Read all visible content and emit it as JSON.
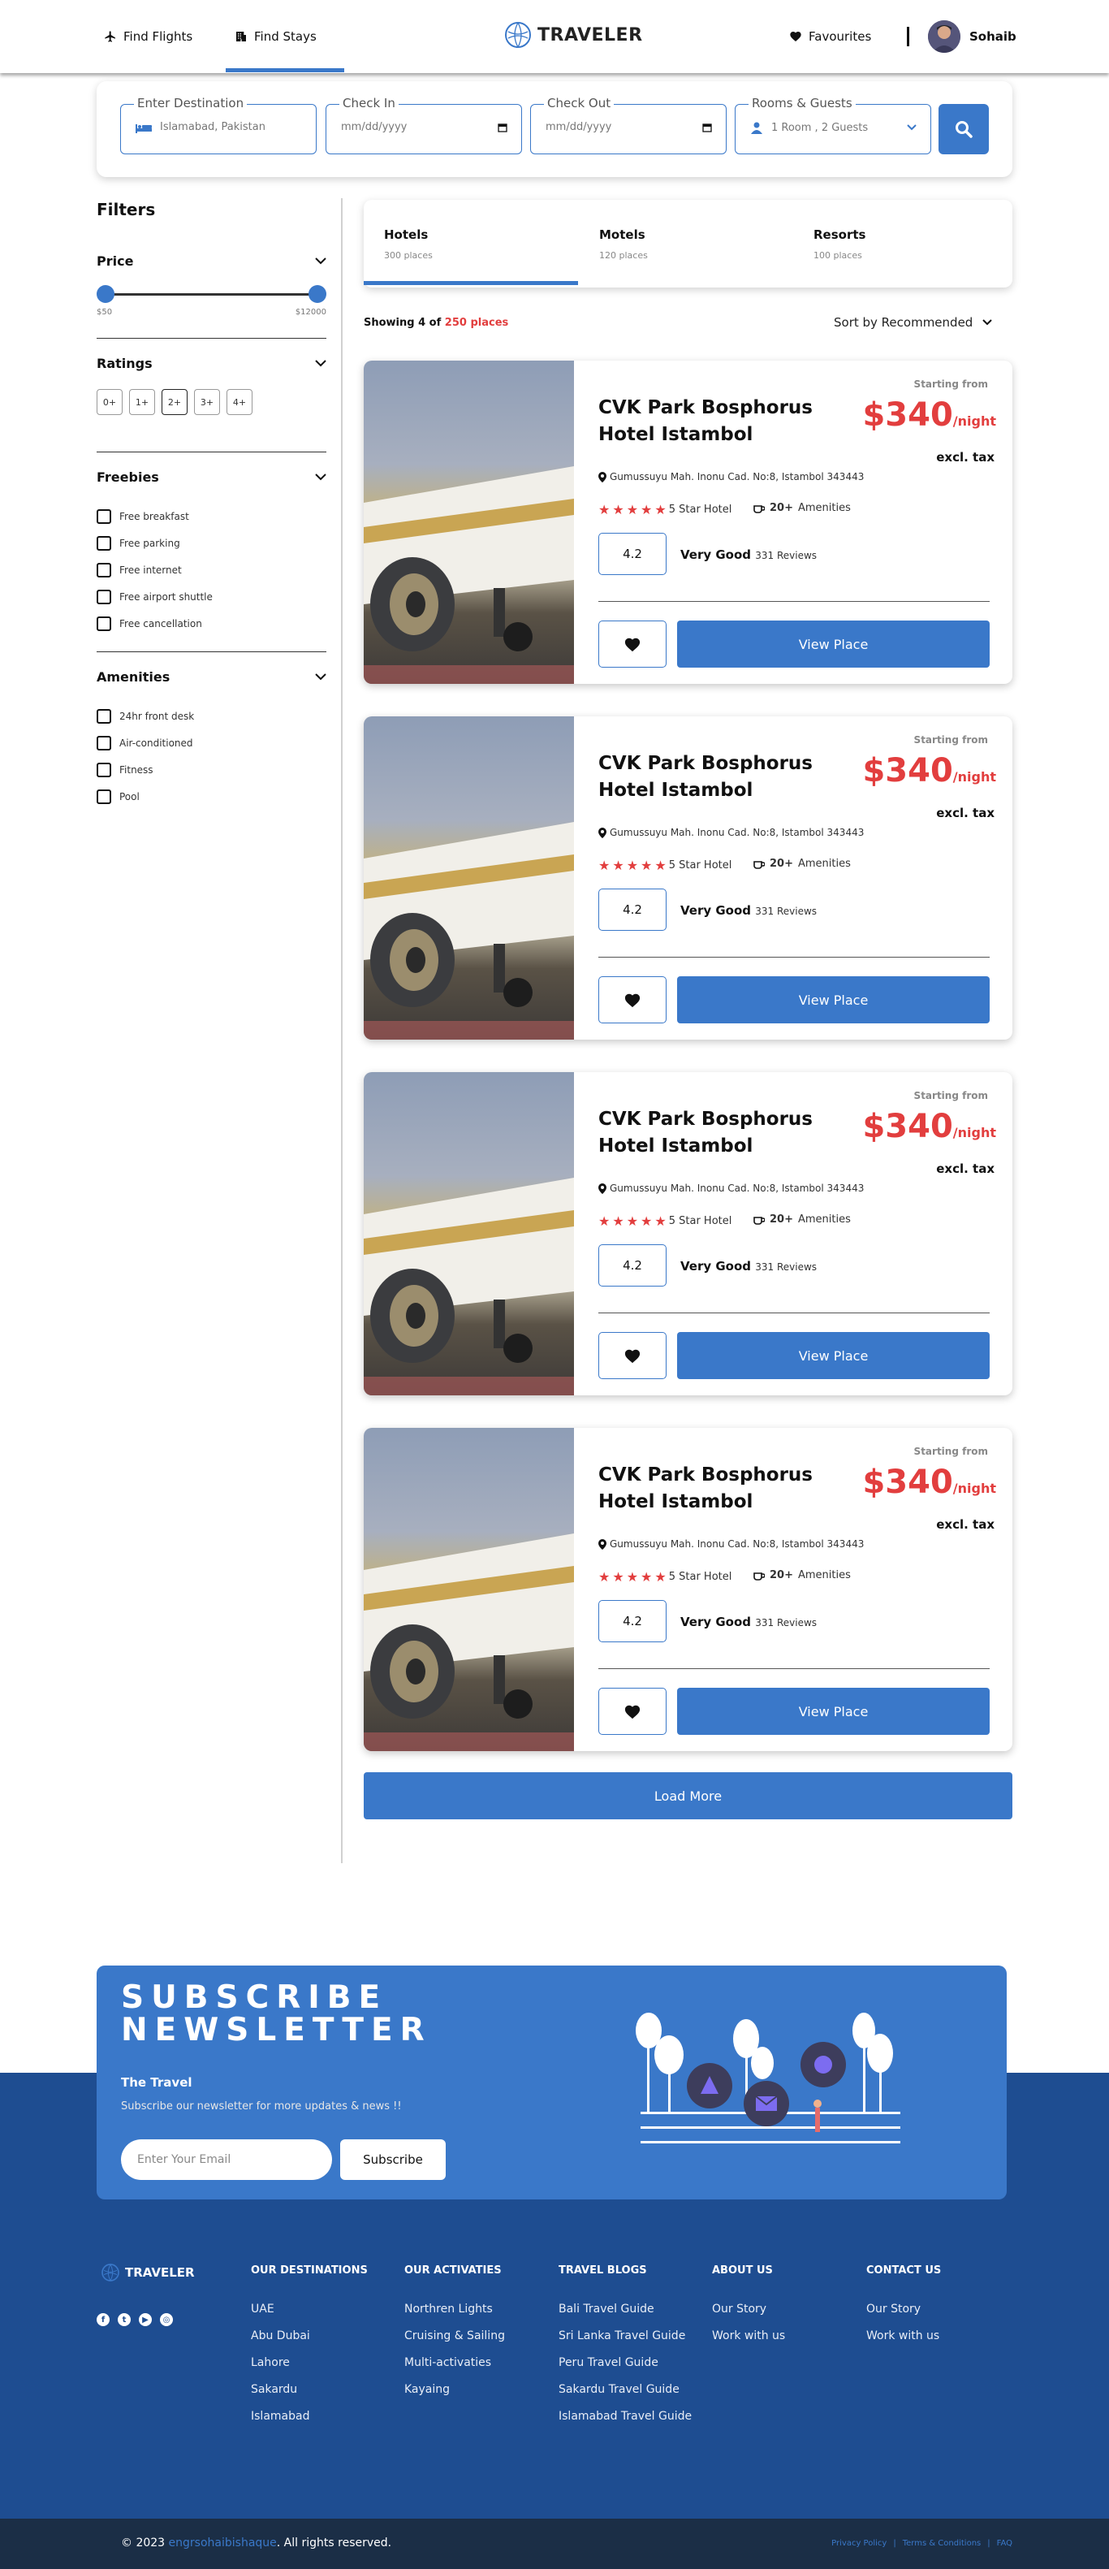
{
  "nav": {
    "find_flights": "Find Flights",
    "find_stays": "Find Stays",
    "logo": "TRAVELER",
    "favourites": "Favourites",
    "user": "Sohaib"
  },
  "search": {
    "destination_label": "Enter Destination",
    "destination_value": "Islamabad, Pakistan",
    "checkin_label": "Check In",
    "checkin_value": "mm/dd/yyyy",
    "checkout_label": "Check Out",
    "checkout_value": "mm/dd/yyyy",
    "rooms_label": "Rooms & Guests",
    "rooms_value": "1 Room , 2 Guests"
  },
  "filters": {
    "title": "Filters",
    "price": {
      "label": "Price",
      "min": "$50",
      "max": "$12000"
    },
    "ratings": {
      "label": "Ratings",
      "options": [
        "0+",
        "1+",
        "2+",
        "3+",
        "4+"
      ]
    },
    "freebies": {
      "label": "Freebies",
      "options": [
        "Free breakfast",
        "Free parking",
        "Free internet",
        "Free airport shuttle",
        "Free cancellation"
      ]
    },
    "amenities": {
      "label": "Amenities",
      "options": [
        "24hr front desk",
        "Air-conditioned",
        "Fitness",
        "Pool"
      ]
    }
  },
  "tabs": [
    {
      "label": "Hotels",
      "count": "300 places"
    },
    {
      "label": "Motels",
      "count": "120 places"
    },
    {
      "label": "Resorts",
      "count": "100 places"
    }
  ],
  "results": {
    "showing_prefix": "Showing 4 of",
    "showing_total": "250 places",
    "sort": "Sort by Recommended"
  },
  "cards": [
    {
      "title": "CVK Park Bosphorus Hotel Istambol",
      "starting": "Starting from",
      "price": "$340",
      "per": "/night",
      "excl": "excl. tax",
      "address": "Gumussuyu Mah. Inonu Cad. No:8, Istambol 343443",
      "hotel_class": "5 Star Hotel",
      "amenities_count": "20+",
      "amenities_label": "Amenities",
      "rating": "4.2",
      "rating_label": "Very Good",
      "reviews": "331 Reviews",
      "view": "View Place"
    },
    {
      "title": "CVK Park Bosphorus Hotel Istambol",
      "starting": "Starting from",
      "price": "$340",
      "per": "/night",
      "excl": "excl. tax",
      "address": "Gumussuyu Mah. Inonu Cad. No:8, Istambol 343443",
      "hotel_class": "5 Star Hotel",
      "amenities_count": "20+",
      "amenities_label": "Amenities",
      "rating": "4.2",
      "rating_label": "Very Good",
      "reviews": "331 Reviews",
      "view": "View Place"
    },
    {
      "title": "CVK Park Bosphorus Hotel Istambol",
      "starting": "Starting from",
      "price": "$340",
      "per": "/night",
      "excl": "excl. tax",
      "address": "Gumussuyu Mah. Inonu Cad. No:8, Istambol 343443",
      "hotel_class": "5 Star Hotel",
      "amenities_count": "20+",
      "amenities_label": "Amenities",
      "rating": "4.2",
      "rating_label": "Very Good",
      "reviews": "331 Reviews",
      "view": "View Place"
    },
    {
      "title": "CVK Park Bosphorus Hotel Istambol",
      "starting": "Starting from",
      "price": "$340",
      "per": "/night",
      "excl": "excl. tax",
      "address": "Gumussuyu Mah. Inonu Cad. No:8, Istambol 343443",
      "hotel_class": "5 Star Hotel",
      "amenities_count": "20+",
      "amenities_label": "Amenities",
      "rating": "4.2",
      "rating_label": "Very Good",
      "reviews": "331 Reviews",
      "view": "View Place"
    }
  ],
  "load_more": "Load More",
  "newsletter": {
    "title_1": "SUBSCRIBE",
    "title_2": "NEWSLETTER",
    "subtitle": "The Travel",
    "desc": "Subscribe our newsletter for more updates & news !!",
    "placeholder": "Enter Your Email",
    "button": "Subscribe"
  },
  "footer": {
    "logo": "TRAVELER",
    "columns": [
      {
        "title": "OUR DESTINATIONS",
        "items": [
          "UAE",
          "Abu Dubai",
          "Lahore",
          "Sakardu",
          "Islamabad"
        ]
      },
      {
        "title": "OUR ACTIVATIES",
        "items": [
          "Northren Lights",
          "Cruising & Sailing",
          "Multi-activaties",
          "Kayaing"
        ]
      },
      {
        "title": "TRAVEL BLOGS",
        "items": [
          "Bali Travel Guide",
          "Sri Lanka Travel Guide",
          "Peru Travel Guide",
          "Sakardu Travel Guide",
          "Islamabad Travel Guide"
        ]
      },
      {
        "title": "ABOUT US",
        "items": [
          "Our Story",
          "Work with us"
        ]
      },
      {
        "title": "CONTACT US",
        "items": [
          "Our Story",
          "Work with us"
        ]
      }
    ],
    "copyright_prefix": "© 2023",
    "copyright_link": "engrsohaibishaque",
    "copyright_suffix": ". All rights reserved.",
    "legal": [
      "Privacy Policy",
      "|",
      "Terms & Conditions",
      "|",
      "FAQ"
    ]
  },
  "colors": {
    "accent": "#3a78c9",
    "price": "#e23e3e",
    "footer": "#1e4d91",
    "bottom_bar": "#1b2e46"
  }
}
